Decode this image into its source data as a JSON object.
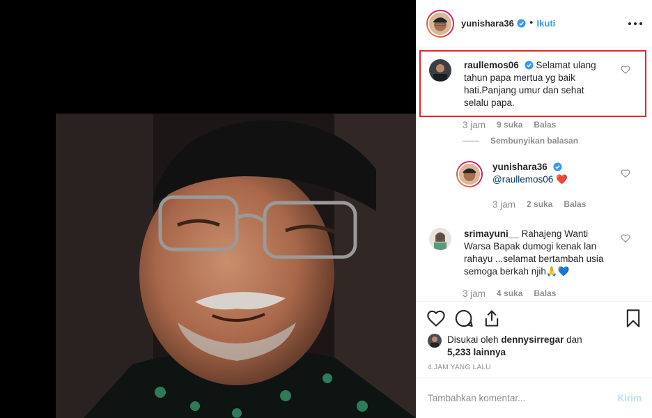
{
  "post": {
    "author": "yunishara36",
    "follow_label": "Ikuti",
    "dot": "•"
  },
  "comments": [
    {
      "user": "raullemos06",
      "text": "Selamat ulang tahun papa mertua yg baik hati.Panjang umur dan sehat selalu papa.",
      "time": "3 jam",
      "likes": "9 suka",
      "reply_label": "Balas"
    },
    {
      "user": "yunishara36",
      "mention": "@raullemos06",
      "emoji": "❤️",
      "time": "3 jam",
      "likes": "2 suka",
      "reply_label": "Balas"
    },
    {
      "user": "srimayuni__",
      "text": "Rahajeng Wanti Warsa Bapak dumogi kenak lan rahayu ...selamat bertambah usia semoga berkah njih🙏💙",
      "time": "3 jam",
      "likes": "4 suka",
      "reply_label": "Balas"
    }
  ],
  "hide_replies_label": "Sembunyikan balasan",
  "likes_summary": {
    "prefix": "Disukai oleh",
    "user": "dennysirregar",
    "joiner": "dan",
    "others": "5,233 lainnya"
  },
  "timestamp": "4 JAM YANG LALU",
  "add_comment": {
    "placeholder": "Tambahkan komentar...",
    "post_label": "Kirim"
  },
  "icons": {
    "like": "heart-icon",
    "comment": "comment-icon",
    "share": "share-icon",
    "save": "bookmark-icon",
    "verified": "verified-badge-icon",
    "more": "more-options-icon"
  },
  "colors": {
    "link": "#3897f0",
    "highlight": "#e0262d",
    "muted": "#8e8e8e"
  }
}
